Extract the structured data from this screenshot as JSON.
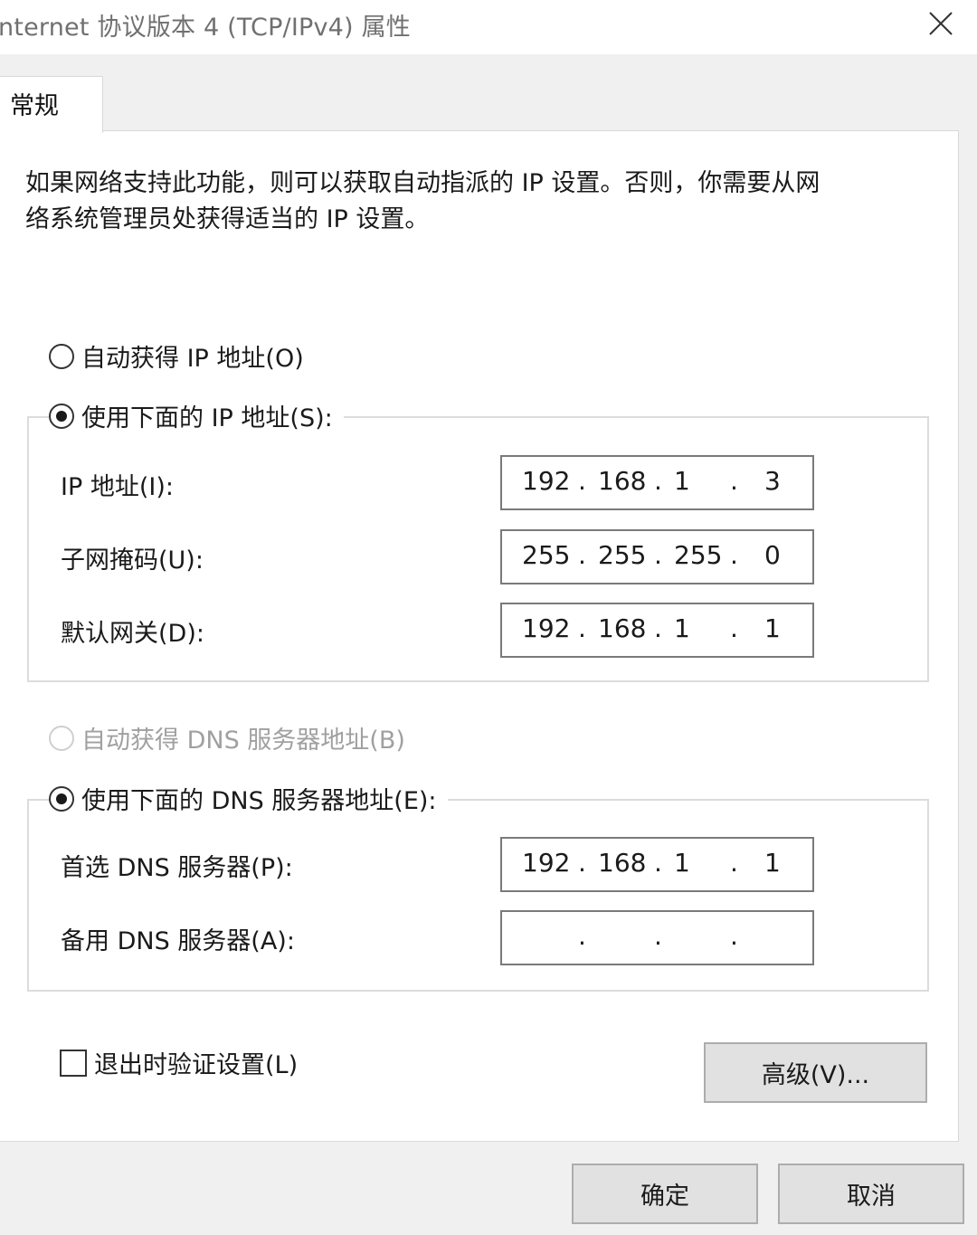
{
  "window": {
    "title": "nternet 协议版本 4 (TCP/IPv4) 属性"
  },
  "tabs": [
    {
      "label": "常规"
    }
  ],
  "description": {
    "line1": "如果网络支持此功能，则可以获取自动指派的 IP 设置。否则，你需要从网",
    "line2": "络系统管理员处获得适当的 IP 设置。"
  },
  "ip_section": {
    "auto_radio": {
      "label": "自动获得 IP 地址(O)",
      "checked": false
    },
    "manual_radio": {
      "label": "使用下面的 IP 地址(S):",
      "checked": true
    },
    "fields": [
      {
        "label": "IP 地址(I):",
        "octets": [
          "192",
          "168",
          "1",
          "3"
        ]
      },
      {
        "label": "子网掩码(U):",
        "octets": [
          "255",
          "255",
          "255",
          "0"
        ]
      },
      {
        "label": "默认网关(D):",
        "octets": [
          "192",
          "168",
          "1",
          "1"
        ]
      }
    ]
  },
  "dns_section": {
    "auto_radio": {
      "label": "自动获得 DNS 服务器地址(B)",
      "checked": false,
      "disabled": true
    },
    "manual_radio": {
      "label": "使用下面的 DNS 服务器地址(E):",
      "checked": true
    },
    "fields": [
      {
        "label": "首选 DNS 服务器(P):",
        "octets": [
          "192",
          "168",
          "1",
          "1"
        ]
      },
      {
        "label": "备用 DNS 服务器(A):",
        "octets": [
          "",
          "",
          "",
          ""
        ]
      }
    ]
  },
  "validate_checkbox": {
    "label": "退出时验证设置(L)",
    "checked": false
  },
  "buttons": {
    "advanced": "高级(V)...",
    "ok": "确定",
    "cancel": "取消"
  },
  "ip_separator": ".",
  "icons": {
    "close": "close-icon"
  },
  "colors": {
    "background": "#f0f0f0",
    "panel": "#ffffff",
    "button": "#e1e1e1",
    "disabled_text": "#a0a0a0"
  }
}
